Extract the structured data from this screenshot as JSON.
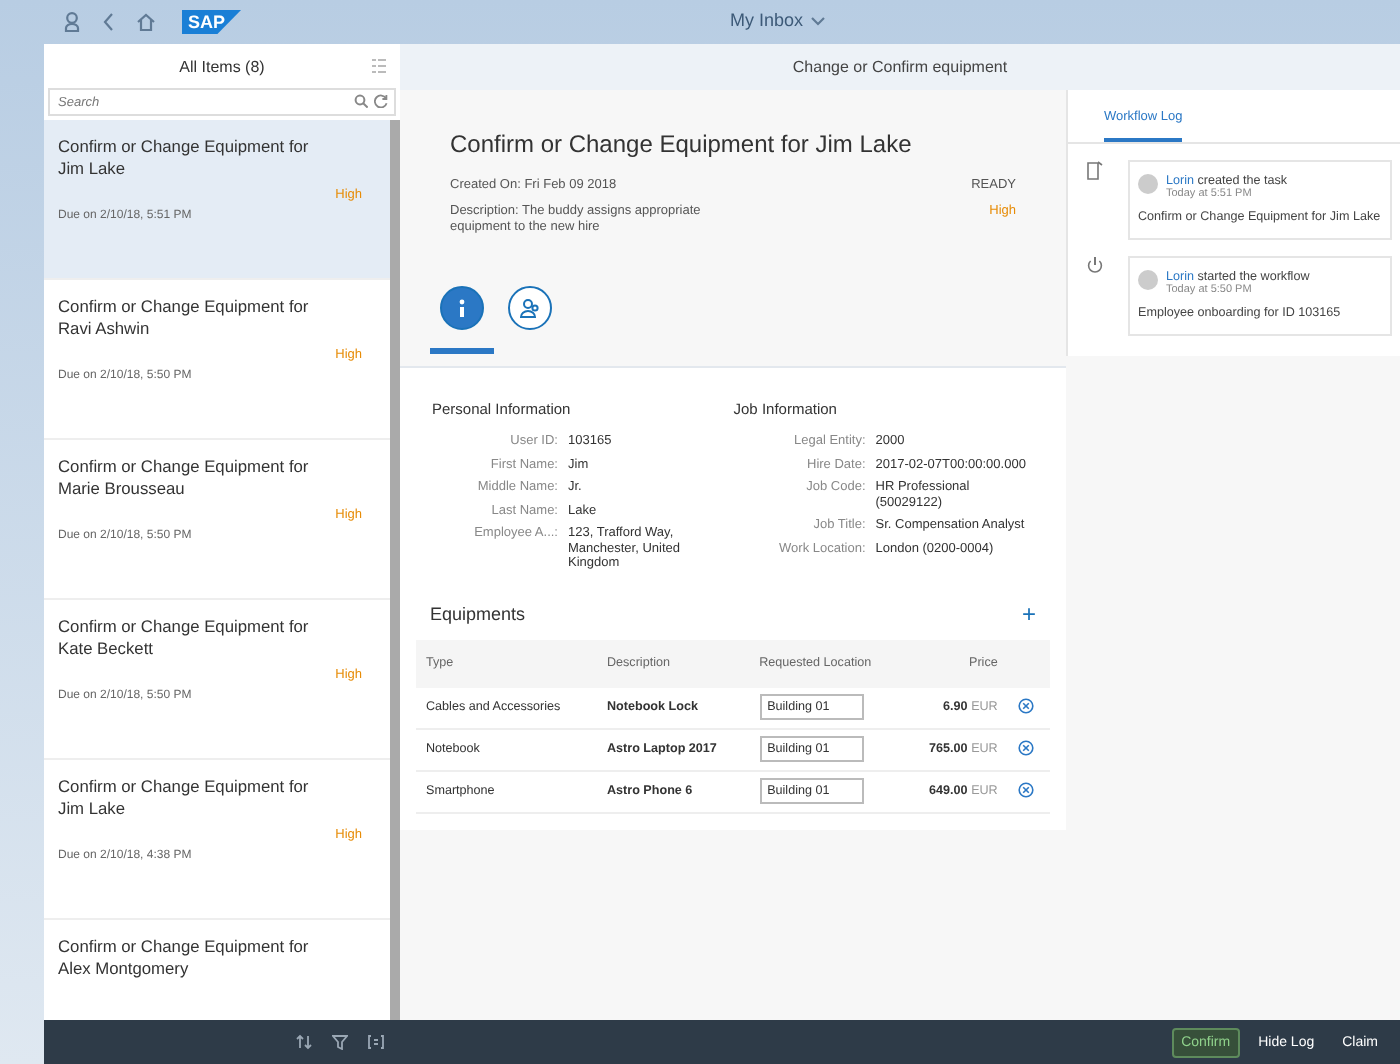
{
  "shell": {
    "logo": "SAP",
    "title": "My Inbox"
  },
  "master": {
    "title": "All Items (8)",
    "search": {
      "placeholder": "Search"
    },
    "items": [
      {
        "title": "Confirm or Change Equipment for Jim Lake",
        "priority": "High",
        "due": "Due on 2/10/18, 5:51 PM",
        "selected": true
      },
      {
        "title": "Confirm or Change Equipment for Ravi Ashwin",
        "priority": "High",
        "due": "Due on 2/10/18, 5:50 PM",
        "selected": false
      },
      {
        "title": "Confirm or Change Equipment for Marie Brousseau",
        "priority": "High",
        "due": "Due on 2/10/18, 5:50 PM",
        "selected": false
      },
      {
        "title": "Confirm or Change Equipment for Kate Beckett",
        "priority": "High",
        "due": "Due on 2/10/18, 5:50 PM",
        "selected": false
      },
      {
        "title": "Confirm or Change Equipment for Jim Lake",
        "priority": "High",
        "due": "Due on 2/10/18, 4:38 PM",
        "selected": false
      },
      {
        "title": "Confirm or Change Equipment for Alex Montgomery",
        "selected": false
      }
    ]
  },
  "detail": {
    "title": "Change or Confirm equipment",
    "header": {
      "title": "Confirm or Change Equipment for Jim Lake",
      "created": "Created On: Fri Feb 09 2018",
      "status": "READY",
      "description": "Description: The buddy assigns appropriate equipment to the new hire",
      "priority": "High"
    },
    "tabs": [
      {
        "kind": "info",
        "selected": true
      },
      {
        "kind": "people",
        "selected": false
      }
    ],
    "personal": {
      "title": "Personal Information",
      "fields": [
        {
          "label": "User ID:",
          "value": "103165"
        },
        {
          "label": "First Name:",
          "value": "Jim"
        },
        {
          "label": "Middle Name:",
          "value": "Jr."
        },
        {
          "label": "Last Name:",
          "value": "Lake"
        },
        {
          "label": "Employee A...:",
          "value": "123, Trafford Way, Manchester, United Kingdom"
        }
      ]
    },
    "job": {
      "title": "Job Information",
      "fields": [
        {
          "label": "Legal Entity:",
          "value": "2000"
        },
        {
          "label": "Hire Date:",
          "value": "2017-02-07T00:00:00.000"
        },
        {
          "label": "Job Code:",
          "value": "HR Professional (50029122)"
        },
        {
          "label": "Job Title:",
          "value": "Sr. Compensation Analyst"
        },
        {
          "label": "Work Location:",
          "value": "London (0200-0004)"
        }
      ]
    },
    "equipments": {
      "title": "Equipments",
      "add": "+",
      "columns": [
        "Type",
        "Description",
        "Requested Location",
        "Price"
      ],
      "rows": [
        {
          "type": "Cables and Accessories",
          "description": "Notebook Lock",
          "location": "Building 01",
          "price": "6.90",
          "currency": "EUR"
        },
        {
          "type": "Notebook",
          "description": "Astro Laptop 2017",
          "location": "Building 01",
          "price": "765.00",
          "currency": "EUR"
        },
        {
          "type": "Smartphone",
          "description": "Astro Phone 6",
          "location": "Building 01",
          "price": "649.00",
          "currency": "EUR"
        }
      ]
    }
  },
  "log": {
    "tab": "Workflow Log",
    "entries": [
      {
        "kind": "task",
        "user": "Lorin",
        "action": "created the task",
        "time": "Today at 5:51 PM",
        "text": "Confirm or Change Equipment for Jim Lake"
      },
      {
        "kind": "start",
        "user": "Lorin",
        "action": "started the workflow",
        "time": "Today at 5:50 PM",
        "text": "Employee onboarding for ID 103165"
      }
    ]
  },
  "footer": {
    "buttons": [
      {
        "label": "Confirm",
        "kind": "accept"
      },
      {
        "label": "Hide Log",
        "kind": "plain"
      },
      {
        "label": "Claim",
        "kind": "plain"
      }
    ]
  }
}
